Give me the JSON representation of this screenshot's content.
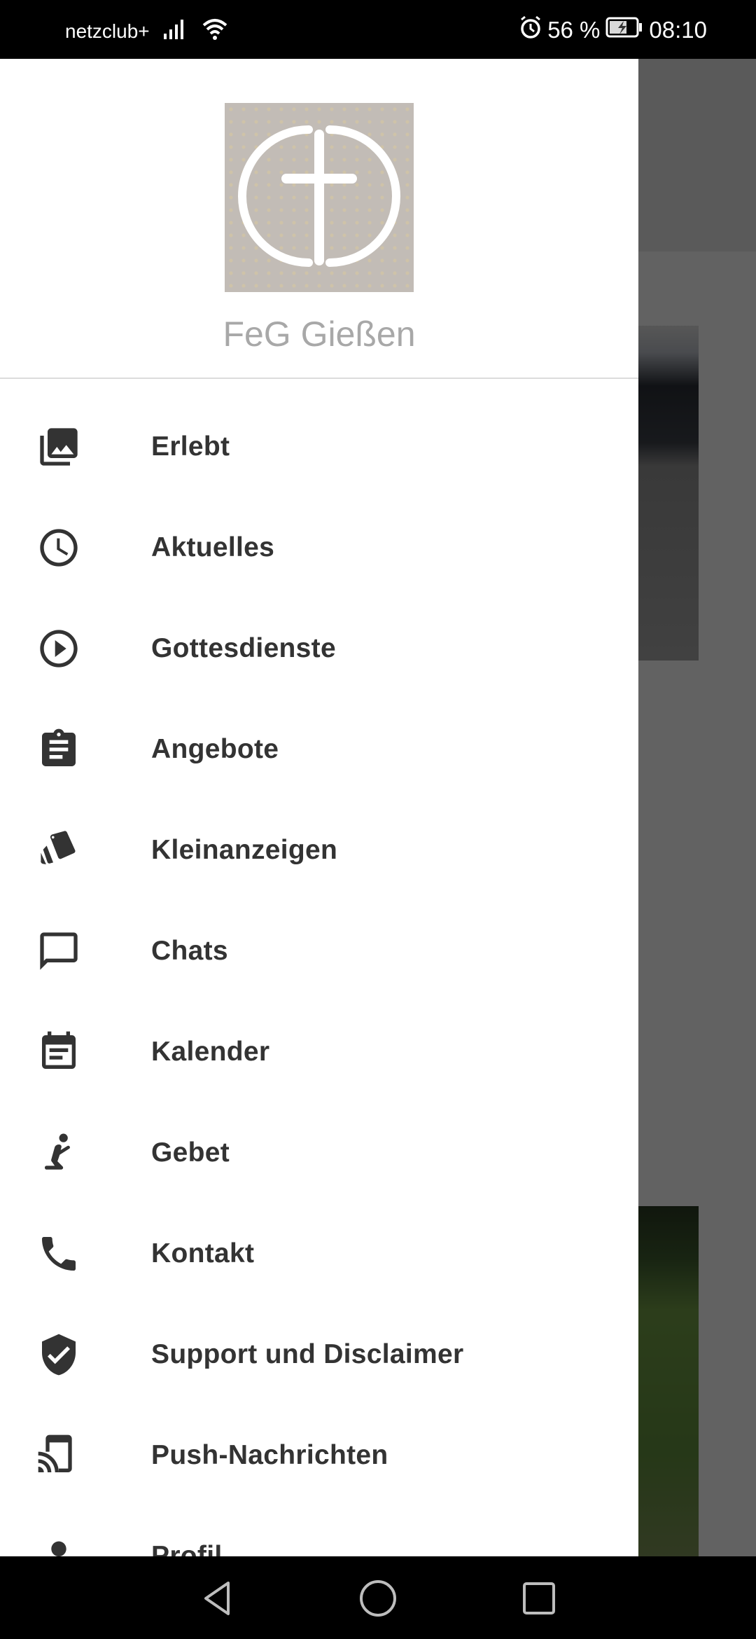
{
  "status_bar": {
    "carrier": "netzclub+",
    "battery_percent": "56 %",
    "time": "08:10",
    "icons": [
      "signal-icon",
      "wifi-icon",
      "alarm-icon",
      "battery-charging-icon"
    ]
  },
  "drawer": {
    "org_name": "FeG Gießen",
    "logo": "cross-in-circle-logo",
    "menu_items": [
      {
        "label": "Erlebt",
        "icon": "photo-library-icon"
      },
      {
        "label": "Aktuelles",
        "icon": "clock-icon"
      },
      {
        "label": "Gottesdienste",
        "icon": "play-circle-icon"
      },
      {
        "label": "Angebote",
        "icon": "clipboard-icon"
      },
      {
        "label": "Kleinanzeigen",
        "icon": "tags-icon"
      },
      {
        "label": "Chats",
        "icon": "chat-bubble-icon"
      },
      {
        "label": "Kalender",
        "icon": "calendar-icon"
      },
      {
        "label": "Gebet",
        "icon": "praying-person-icon"
      },
      {
        "label": "Kontakt",
        "icon": "phone-icon"
      },
      {
        "label": "Support und Disclaimer",
        "icon": "shield-check-icon"
      },
      {
        "label": "Push-Nachrichten",
        "icon": "cast-device-icon"
      },
      {
        "label": "Profil",
        "icon": "person-icon"
      }
    ]
  },
  "nav_bar": {
    "back": "back-icon",
    "home": "home-icon",
    "recents": "recents-icon"
  },
  "colors": {
    "icon_text": "#333333",
    "org_name": "#a8a8a8",
    "scrim": "rgba(0,0,0,0.6)"
  }
}
